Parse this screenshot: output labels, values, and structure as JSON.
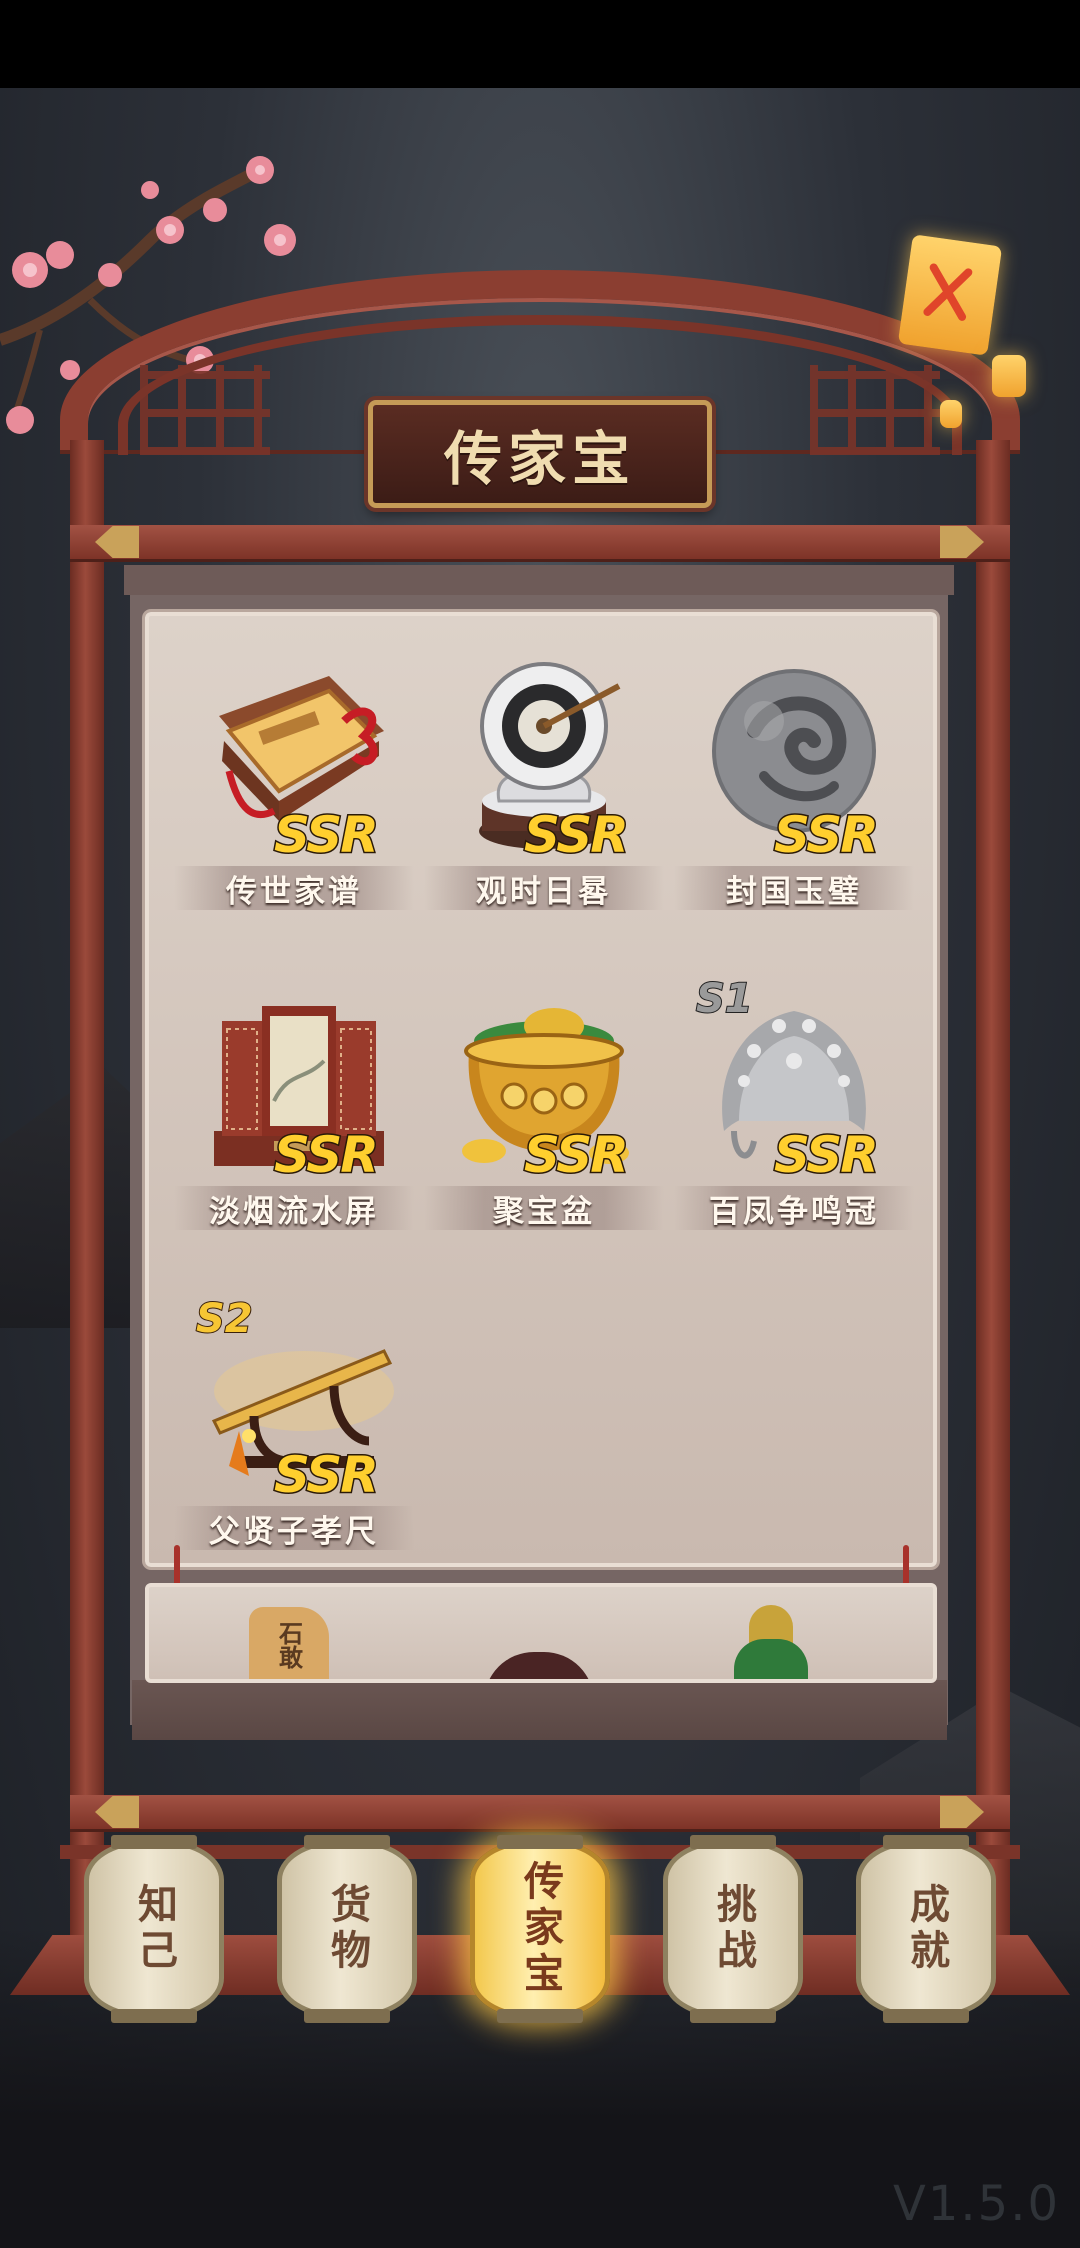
{
  "title": "传家宝",
  "items": [
    {
      "name": "传世家谱",
      "rarity": "SSR",
      "level": ""
    },
    {
      "name": "观时日晷",
      "rarity": "SSR",
      "level": ""
    },
    {
      "name": "封国玉璧",
      "rarity": "SSR",
      "level": ""
    },
    {
      "name": "淡烟流水屏",
      "rarity": "SSR",
      "level": ""
    },
    {
      "name": "聚宝盆",
      "rarity": "SSR",
      "level": ""
    },
    {
      "name": "百凤争鸣冠",
      "rarity": "SSR",
      "level": "S1"
    },
    {
      "name": "父贤子孝尺",
      "rarity": "SSR",
      "level": "S2"
    }
  ],
  "partial_item_text": "石敢",
  "tabs": [
    {
      "label": "知己",
      "active": false
    },
    {
      "label": "货物",
      "active": false
    },
    {
      "label": "传家宝",
      "active": true
    },
    {
      "label": "挑战",
      "active": false
    },
    {
      "label": "成就",
      "active": false
    }
  ],
  "version": "V1.5.0",
  "colors": {
    "rarity": "#ffcf2e",
    "frame": "#8b3e31",
    "active_tab": "#f3c84d"
  }
}
